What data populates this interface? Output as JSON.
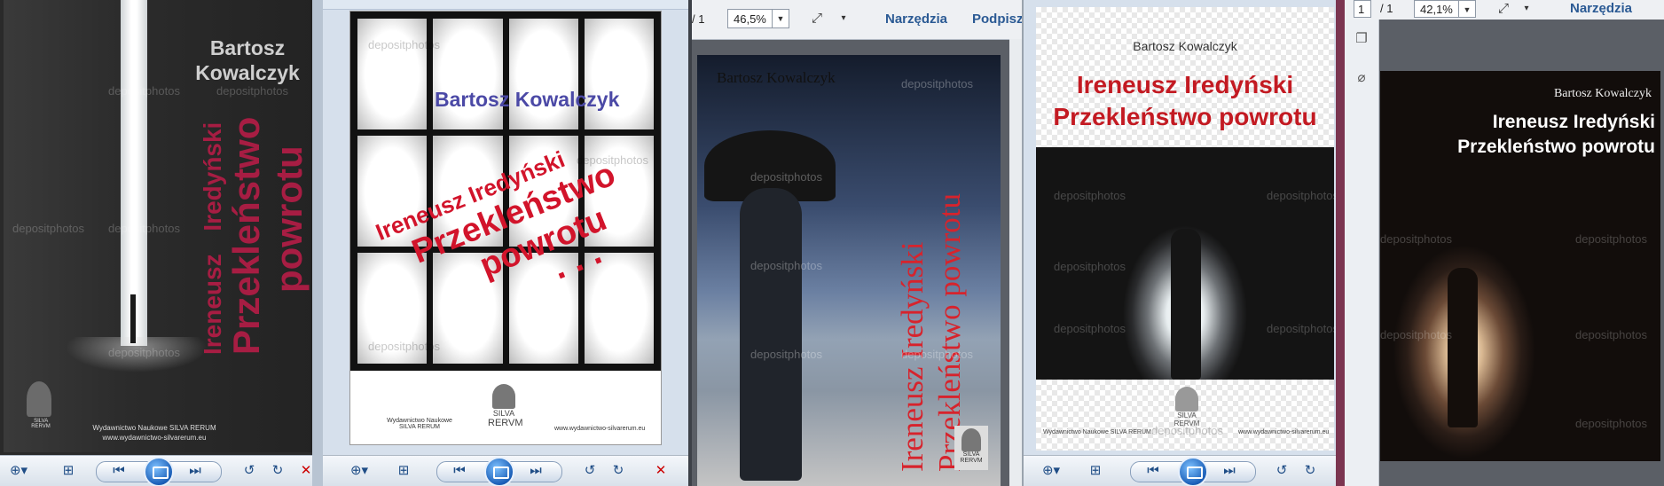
{
  "author": "Bartosz Kowalczyk",
  "author_first": "Bartosz",
  "author_last": "Kowalczyk",
  "author_split_a": "Bartosz Kowal",
  "author_split_b": "czyk",
  "author_gap": "Kowal",
  "author_tail": "czyk",
  "poet": "Ireneusz Iredyński",
  "poet_first": "Ireneusz",
  "poet_last": "Iredyński",
  "title": "Przekleństwo powrotu",
  "title_word1": "Przekleństwo",
  "title_word2": "powrotu",
  "ellipsis": ". . .",
  "watermark": "depositphotos",
  "publisher_name": "Wydawnictwo Naukowe",
  "publisher_brand": "SILVA RERUM",
  "publisher_line": "Wydawnictwo Naukowe SILVA RERUM",
  "publisher_url": "www.wydawnictwo-silvarerum.eu",
  "logo_top": "SILVA",
  "logo_bottom": "RERVM",
  "acrobat1": {
    "page_sep": "/ 1",
    "zoom": "46,5%",
    "tools": "Narzędzia",
    "sign": "Podpisz"
  },
  "acrobat2": {
    "page_input": "1",
    "page_sep": "/ 1",
    "zoom": "42,1%",
    "tools": "Narzędzia"
  },
  "icons": {
    "zoom": "zoom-in-icon",
    "fit": "fit-icon",
    "prev": "previous-icon",
    "next": "next-icon",
    "rotl": "rotate-left-icon",
    "rotr": "rotate-right-icon",
    "delete": "delete-icon"
  }
}
